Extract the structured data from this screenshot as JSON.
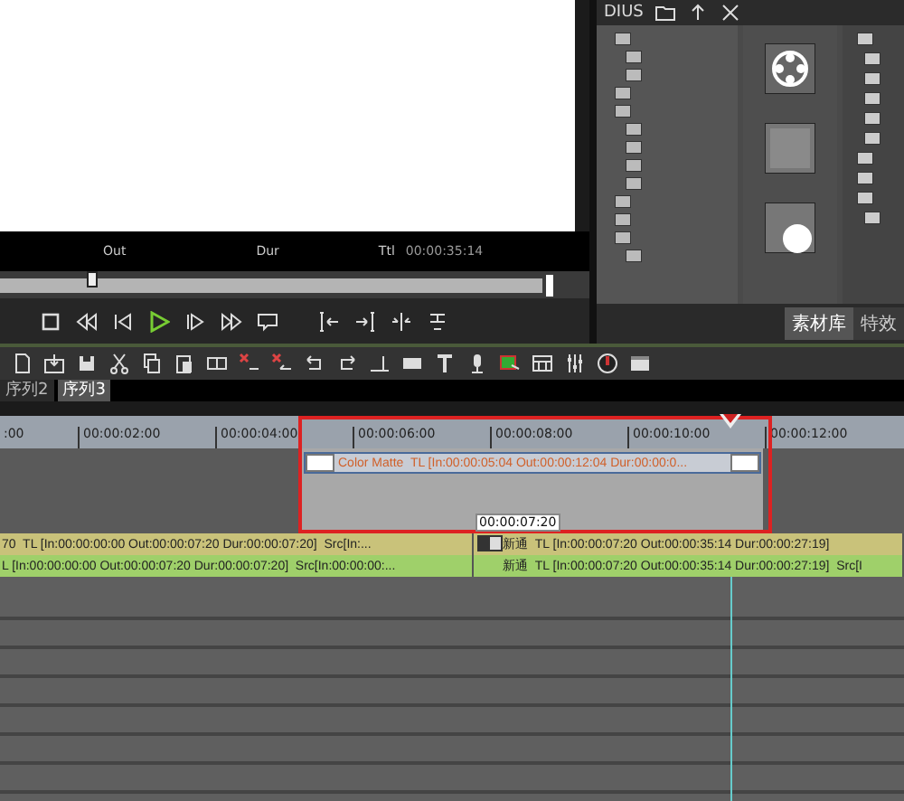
{
  "monitor": {
    "labels": [
      "Out",
      "Dur",
      "Ttl"
    ],
    "total": "00:00:35:14"
  },
  "scrubber": {
    "level": 0.17
  },
  "bin": {
    "title_fragment": "DIUS",
    "tabs": [
      {
        "label": "素材库",
        "selected": true
      },
      {
        "label": "特效",
        "selected": false
      }
    ]
  },
  "sequence_tabs": [
    {
      "label": "序列2",
      "selected": false
    },
    {
      "label": "序列3",
      "selected": true
    }
  ],
  "ruler": [
    ":00",
    "00:00:02:00",
    "00:00:04:00",
    "00:00:06:00",
    "00:00:08:00",
    "00:00:10:00",
    "00:00:12:00"
  ],
  "title_clip": {
    "name": "Color Matte",
    "info": "TL [In:00:00:05:04 Out:00:00:12:04 Dur:00:00:0..."
  },
  "tooltip": "00:00:07:20",
  "tracks": [
    {
      "color": "#c9c27a",
      "clips": [
        {
          "text": "70  TL [In:00:00:00:00 Out:00:00:07:20 Dur:00:00:07:20]  Src[In:..."
        },
        {
          "text": "新通  TL [In:00:00:07:20 Out:00:00:35:14 Dur:00:00:27:19]"
        }
      ]
    },
    {
      "color": "#9fd06a",
      "clips": [
        {
          "text": "L [In:00:00:00:00 Out:00:00:07:20 Dur:00:00:07:20]  Src[In:00:00:00:..."
        },
        {
          "text": "新通  TL [In:00:00:07:20 Out:00:00:35:14 Dur:00:00:27:19]  Src[I"
        }
      ]
    }
  ]
}
